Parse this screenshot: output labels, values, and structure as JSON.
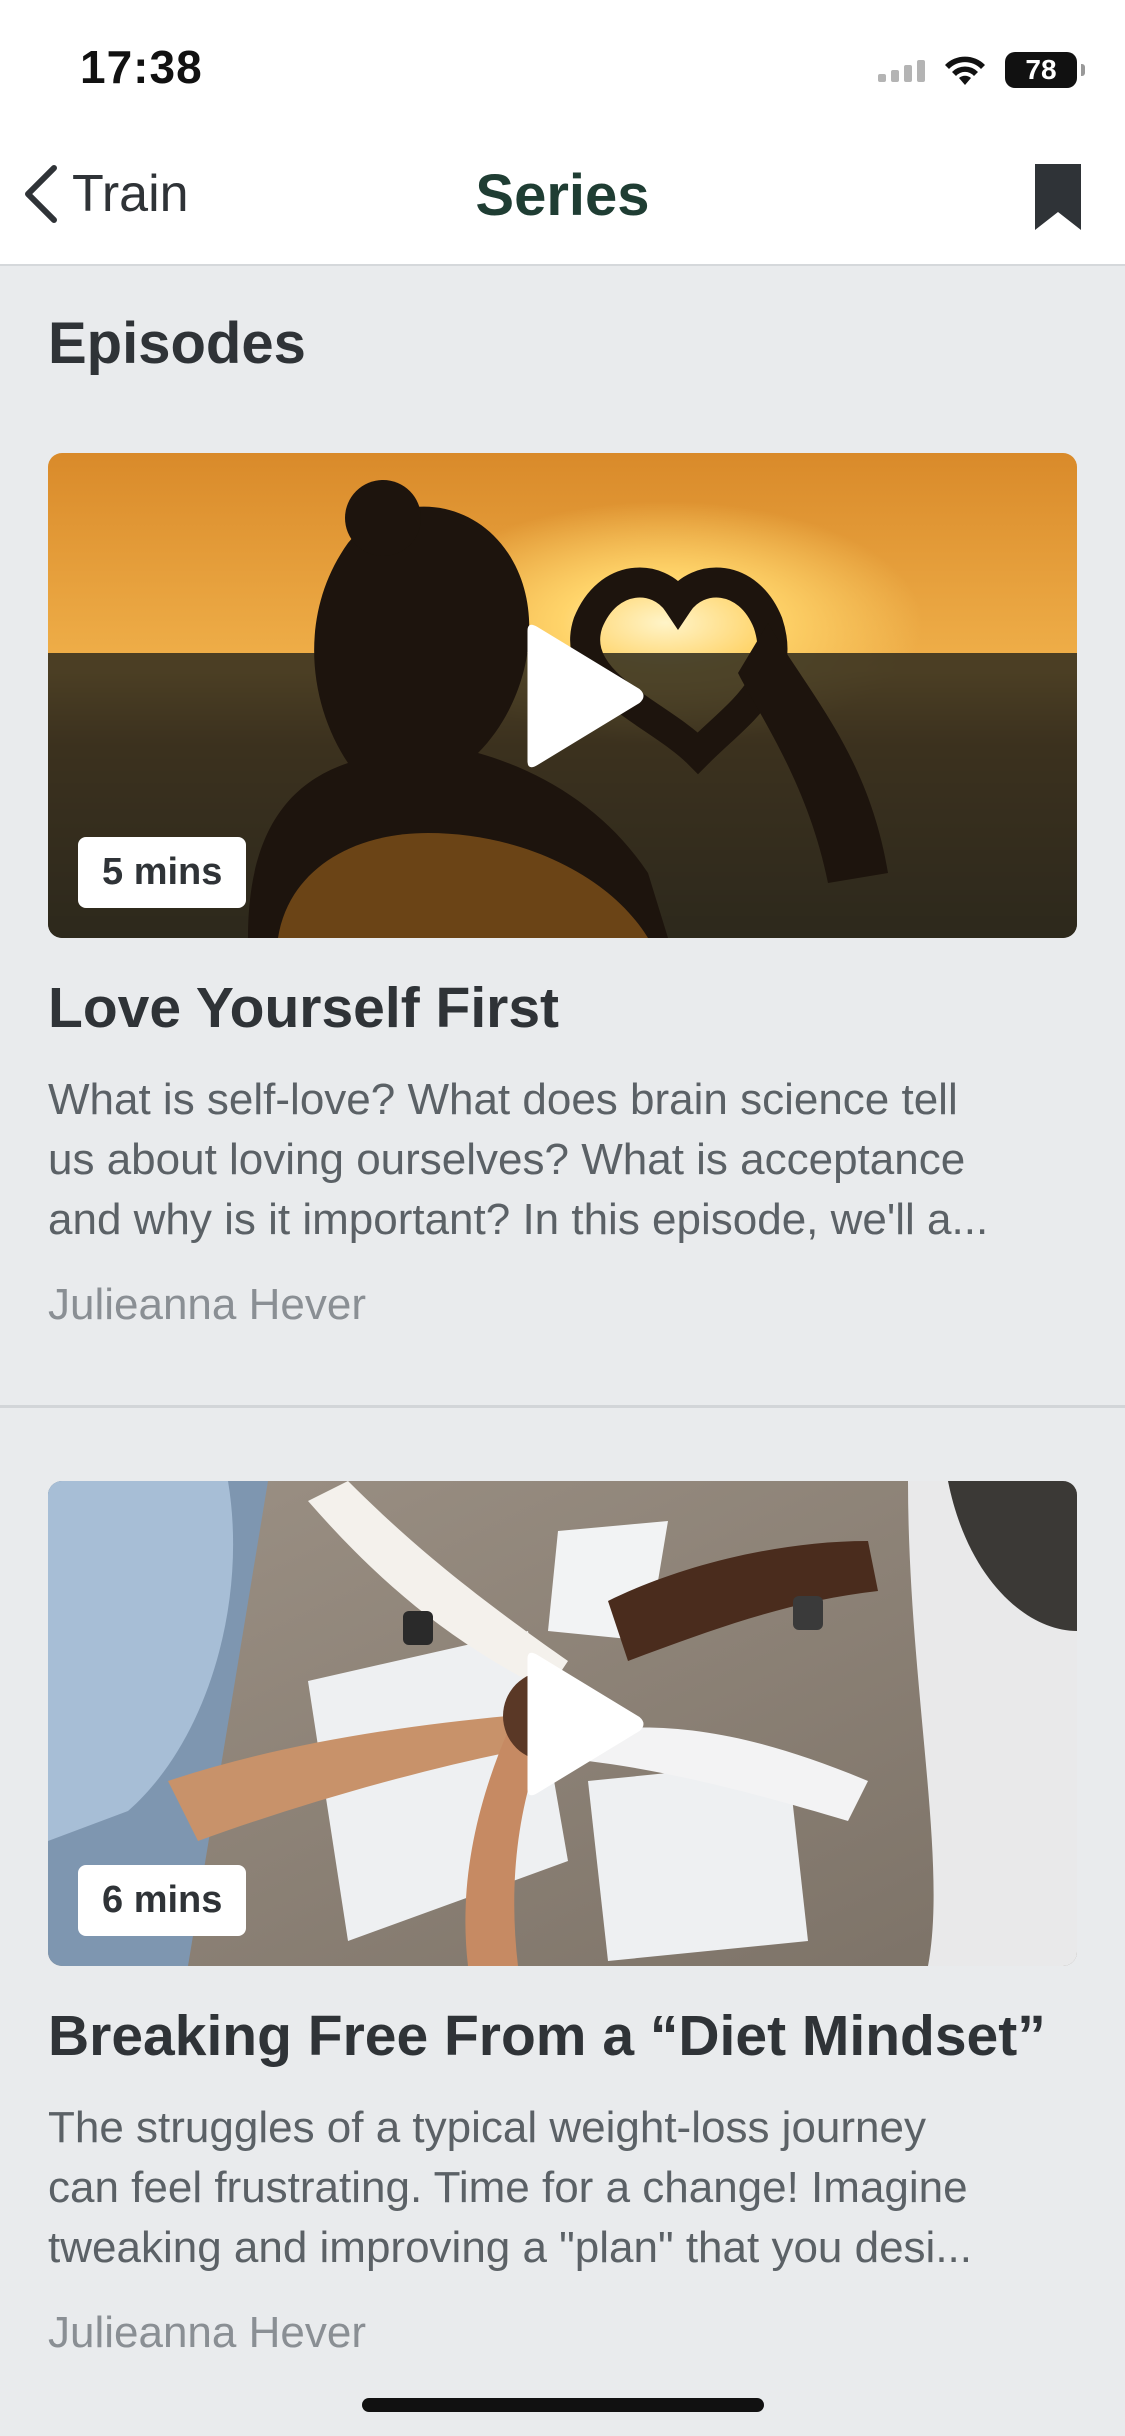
{
  "status_bar": {
    "time": "17:38",
    "battery": "78"
  },
  "nav": {
    "back_label": "Train",
    "title": "Series"
  },
  "section_title": "Episodes",
  "episodes": [
    {
      "duration": "5 mins",
      "title": "Love Yourself First",
      "description_lines": [
        "What is self-love? What does brain science tell",
        "us about loving ourselves? What is acceptance",
        "and why is it important? In this episode, we'll a..."
      ],
      "author": "Julieanna Hever"
    },
    {
      "duration": "6 mins",
      "title": "Breaking Free From a “Diet Mindset”",
      "description_lines": [
        "The struggles of a typical weight-loss journey",
        "can feel frustrating. Time for a change! Imagine",
        "tweaking and improving a \"plan\" that you desi..."
      ],
      "author": "Julieanna Hever"
    }
  ]
}
